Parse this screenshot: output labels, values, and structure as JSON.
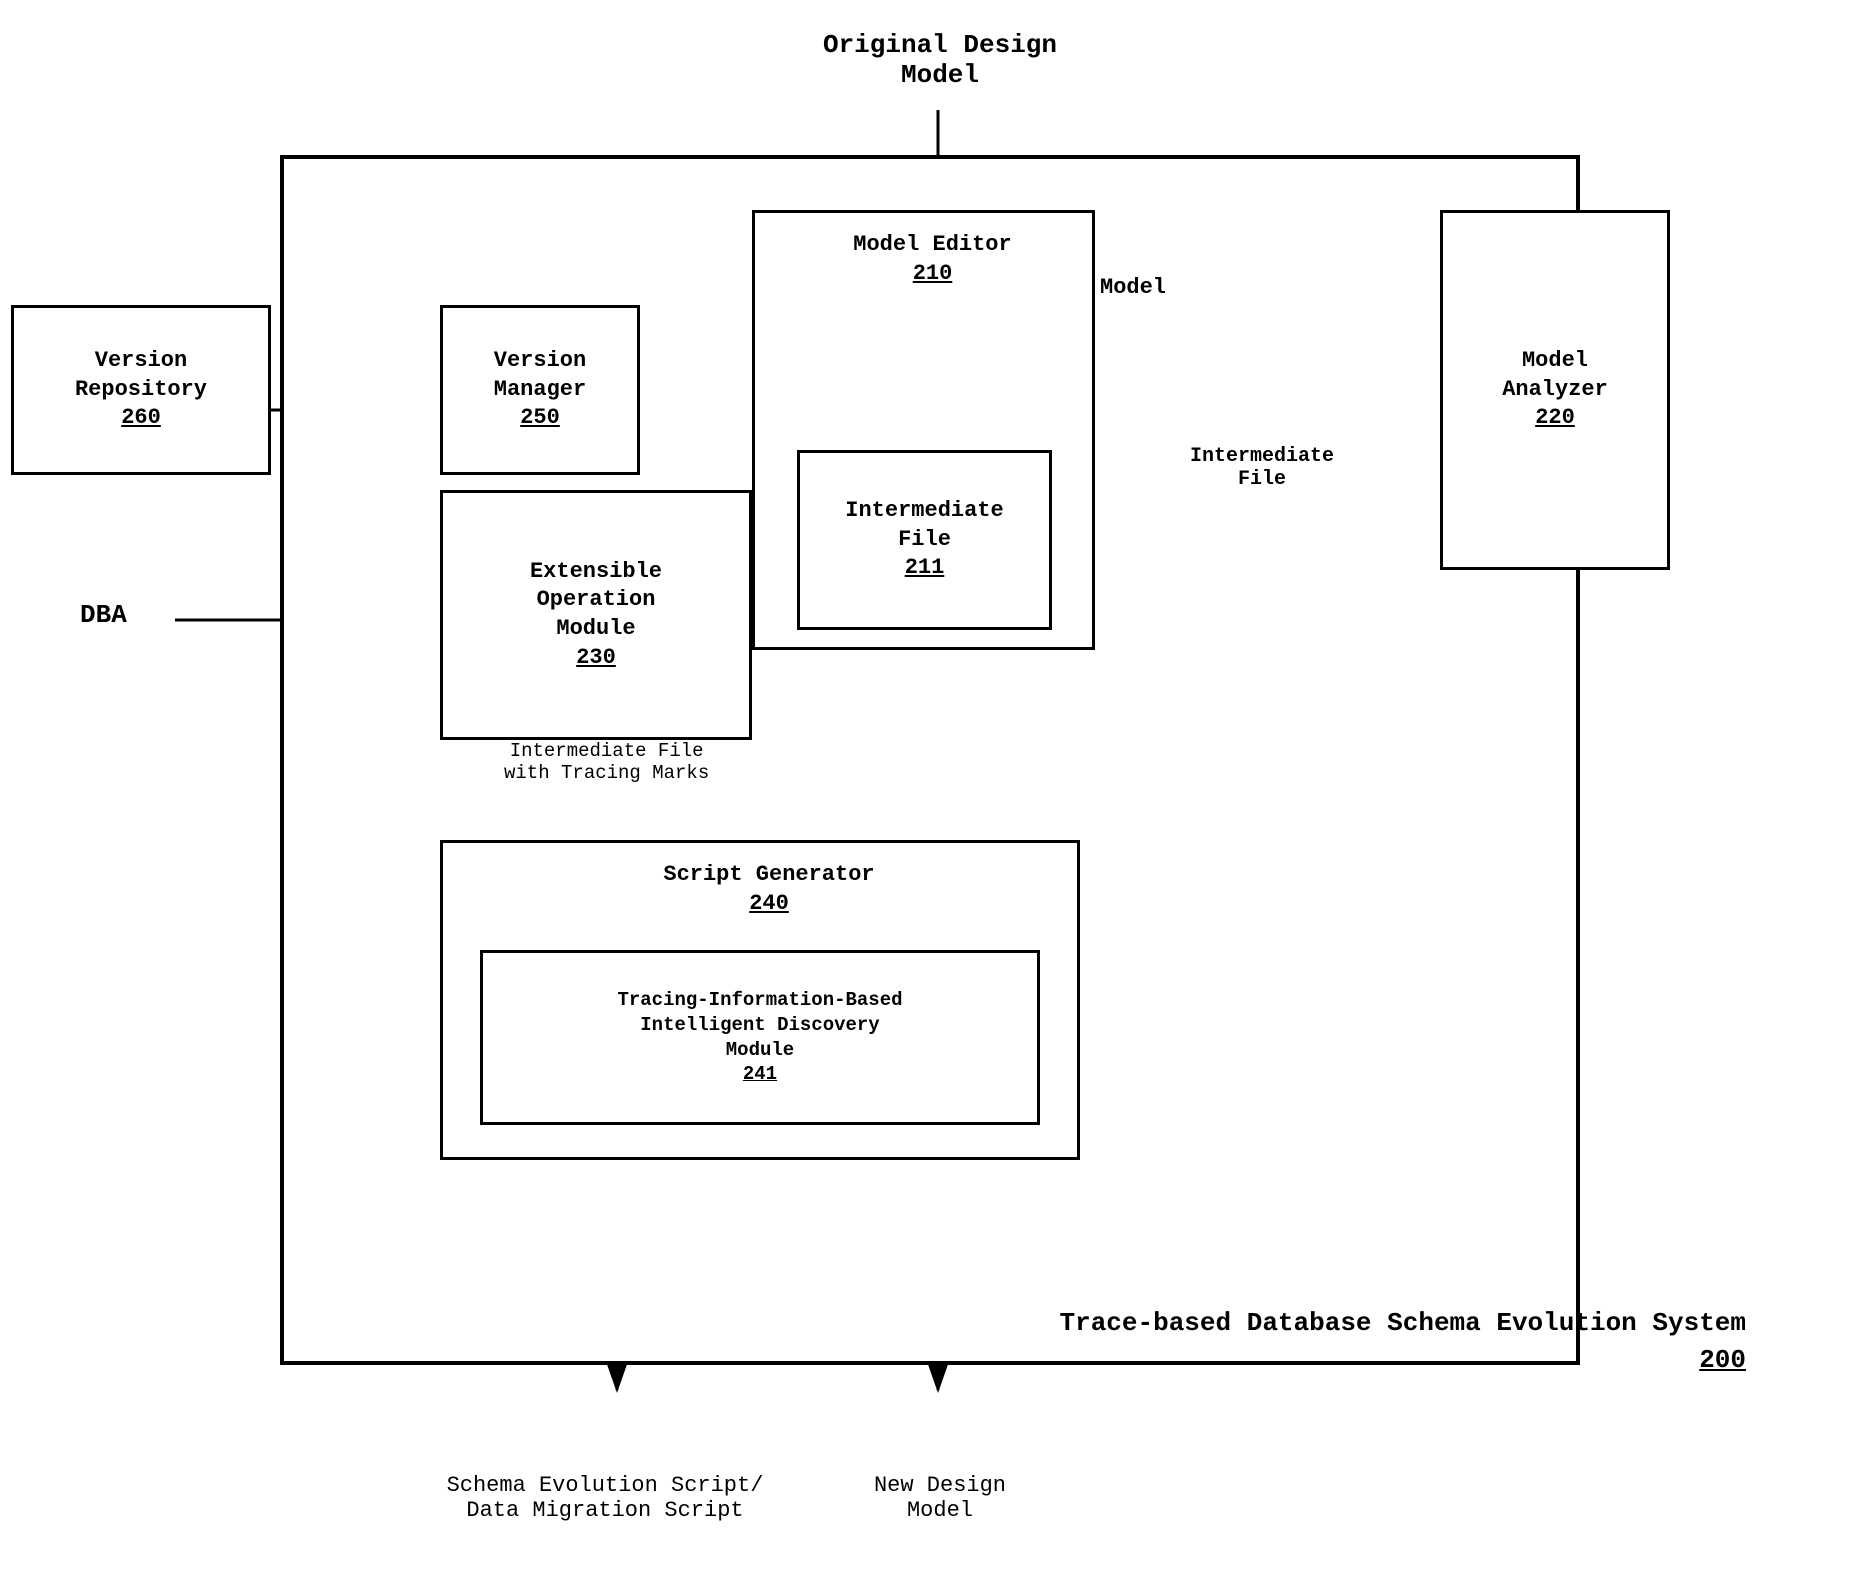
{
  "diagram": {
    "title": "Trace-based Database Schema Evolution System",
    "title_number": "200",
    "original_design_model_label": "Original Design\nModel",
    "dba_label": "DBA",
    "model_label": "Model",
    "intermediate_file_label": "Intermediate\nFile",
    "intermediate_file_tracing_label": "Intermediate File\nwith Tracing Marks",
    "schema_evolution_label": "Schema Evolution Script/\nData Migration Script",
    "new_design_model_label": "New Design\nModel",
    "boxes": [
      {
        "id": "version-repository",
        "name": "Version Repository",
        "number": "260"
      },
      {
        "id": "version-manager",
        "name": "Version Manager",
        "number": "250"
      },
      {
        "id": "model-editor",
        "name": "Model Editor",
        "number": "210"
      },
      {
        "id": "model-analyzer",
        "name": "Model Analyzer",
        "number": "220"
      },
      {
        "id": "intermediate-file",
        "name": "Intermediate File",
        "number": "211"
      },
      {
        "id": "extensible-operation",
        "name": "Extensible Operation Module",
        "number": "230"
      },
      {
        "id": "script-generator",
        "name": "Script Generator",
        "number": "240"
      },
      {
        "id": "intelligent-discovery",
        "name": "Tracing-Information-Based Intelligent Discovery Module",
        "number": "241"
      }
    ]
  }
}
